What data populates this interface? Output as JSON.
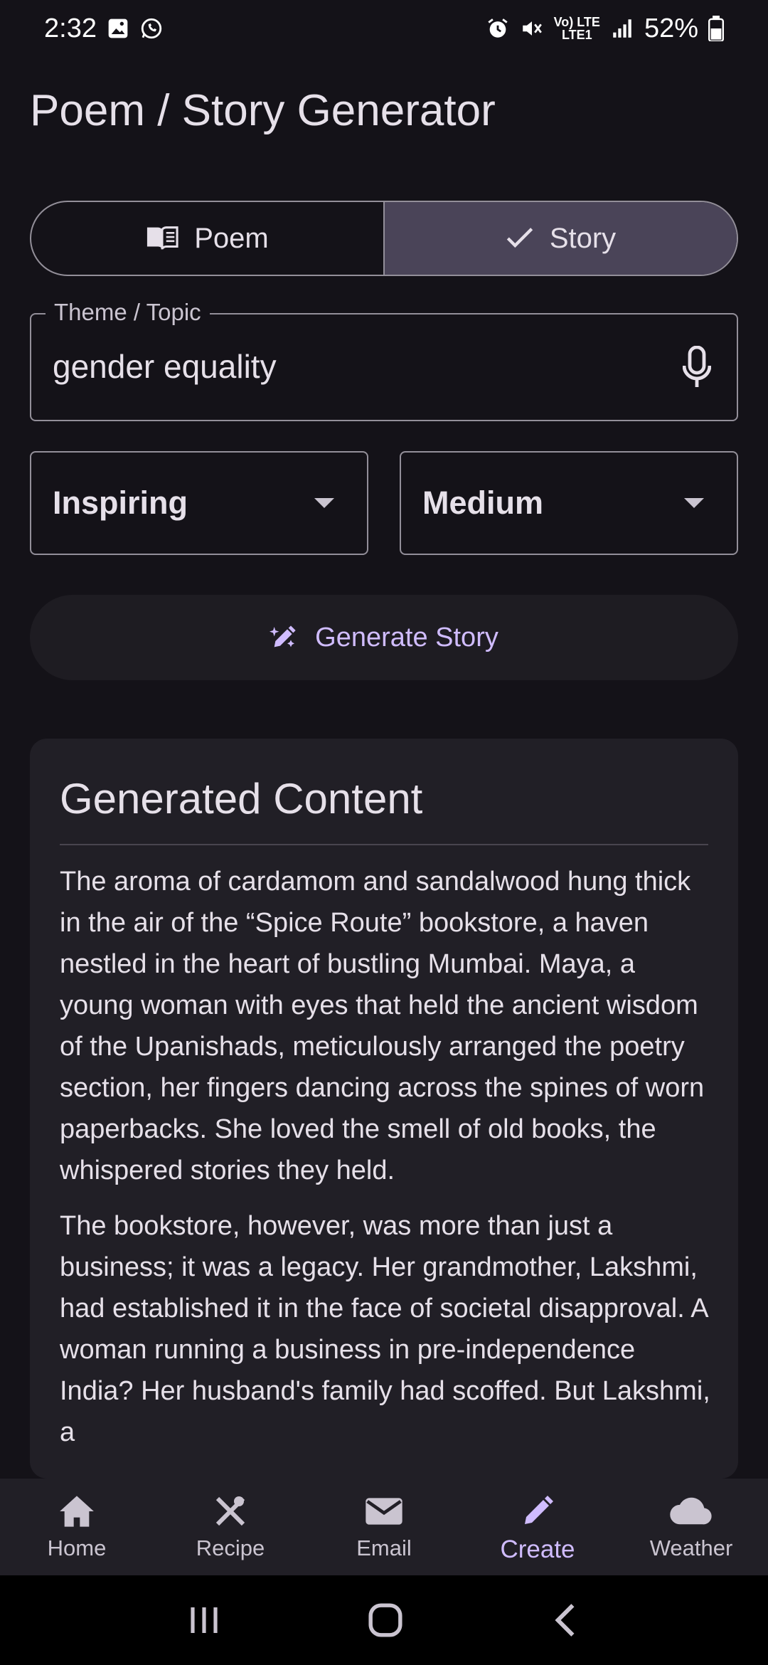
{
  "status_bar": {
    "time": "2:32",
    "battery": "52%",
    "net_top": "Vo) LTE",
    "net_bottom": "LTE1",
    "icons": [
      "gallery-icon",
      "whatsapp-icon",
      "alarm-icon",
      "mute-icon",
      "signal-icon",
      "battery-icon"
    ]
  },
  "app": {
    "title": "Poem / Story Generator"
  },
  "mode": {
    "options": [
      {
        "label": "Poem",
        "icon": "book-icon",
        "selected": false
      },
      {
        "label": "Story",
        "icon": "check-icon",
        "selected": true
      }
    ]
  },
  "theme_field": {
    "label": "Theme / Topic",
    "value": "gender equality",
    "icon": "mic-icon"
  },
  "dropdowns": {
    "tone": {
      "value": "Inspiring"
    },
    "length": {
      "value": "Medium"
    }
  },
  "generate_button": {
    "label": "Generate Story",
    "icon": "magic-pencil-icon"
  },
  "content": {
    "title": "Generated Content",
    "paragraphs": [
      "The aroma of cardamom and sandalwood hung thick in the air of the “Spice Route” bookstore, a haven nestled in the heart of bustling Mumbai. Maya, a young woman with eyes that held the ancient wisdom of the Upanishads, meticulously arranged the poetry section, her fingers dancing across the spines of worn paperbacks. She loved the smell of old books, the whispered stories they held.",
      "The bookstore, however, was more than just a business; it was a legacy. Her grandmother, Lakshmi, had established it in the face of societal disapproval. A woman running a business in pre-independence India? Her husband's family had scoffed. But Lakshmi, a"
    ]
  },
  "bottom_nav": {
    "items": [
      {
        "label": "Home",
        "icon": "home-icon",
        "active": false
      },
      {
        "label": "Recipe",
        "icon": "utensils-icon",
        "active": false
      },
      {
        "label": "Email",
        "icon": "mail-icon",
        "active": false
      },
      {
        "label": "Create",
        "icon": "pencil-icon",
        "active": true
      },
      {
        "label": "Weather",
        "icon": "cloud-icon",
        "active": false
      }
    ]
  },
  "colors": {
    "background": "#141218",
    "accent": "#D0BCFF",
    "selected_segment": "#4A4458",
    "card": "#211F26"
  }
}
